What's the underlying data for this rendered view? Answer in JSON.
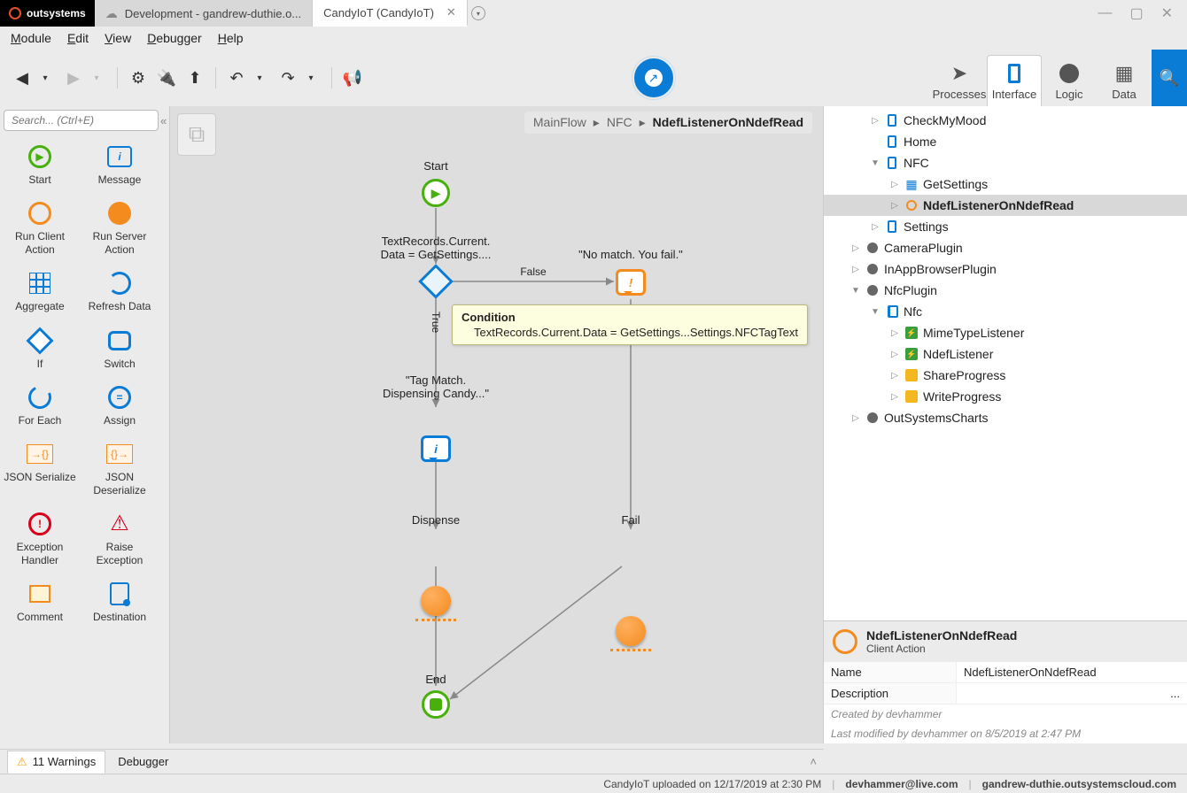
{
  "titlebar": {
    "brand": "outsystems",
    "tabs": [
      {
        "label": "Development - gandrew-duthie.o..."
      },
      {
        "label": "CandyIoT (CandyIoT)"
      }
    ]
  },
  "menubar": {
    "items": [
      "Module",
      "Edit",
      "View",
      "Debugger",
      "Help"
    ]
  },
  "layer_tabs": [
    "Processes",
    "Interface",
    "Logic",
    "Data"
  ],
  "toolbox": {
    "search_placeholder": "Search... (Ctrl+E)",
    "items": [
      "Start",
      "Message",
      "Run Client Action",
      "Run Server Action",
      "Aggregate",
      "Refresh Data",
      "If",
      "Switch",
      "For Each",
      "Assign",
      "JSON Serialize",
      "JSON Deserialize",
      "Exception Handler",
      "Raise Exception",
      "Comment",
      "Destination"
    ]
  },
  "breadcrumb": [
    "MainFlow",
    "NFC",
    "NdefListenerOnNdefRead"
  ],
  "flow": {
    "start_label": "Start",
    "if_label_a": "TextRecords.Current.",
    "if_label_b": "Data = GetSettings....",
    "true_label": "True",
    "false_label": "False",
    "fail_msg": "\"No match. You fail.\"",
    "ok_msg_a": "\"Tag Match.",
    "ok_msg_b": "Dispensing Candy...\"",
    "dispense_label": "Dispense",
    "fail_label": "Fail",
    "end_label": "End"
  },
  "tooltip": {
    "title": "Condition",
    "body": "TextRecords.Current.Data = GetSettings...Settings.NFCTagText"
  },
  "tree": {
    "items": [
      {
        "indent": 1,
        "exp": "▷",
        "icon": "mobile",
        "label": "CheckMyMood"
      },
      {
        "indent": 1,
        "exp": "",
        "icon": "mobile",
        "label": "Home"
      },
      {
        "indent": 1,
        "exp": "▼",
        "icon": "mobile",
        "label": "NFC"
      },
      {
        "indent": 2,
        "exp": "▷",
        "icon": "grid",
        "label": "GetSettings"
      },
      {
        "indent": 2,
        "exp": "▷",
        "icon": "action",
        "label": "NdefListenerOnNdefRead",
        "selected": true
      },
      {
        "indent": 1,
        "exp": "▷",
        "icon": "mobile",
        "label": "Settings"
      },
      {
        "indent": 0,
        "exp": "▷",
        "icon": "gray",
        "label": "CameraPlugin"
      },
      {
        "indent": 0,
        "exp": "▷",
        "icon": "gray",
        "label": "InAppBrowserPlugin"
      },
      {
        "indent": 0,
        "exp": "▼",
        "icon": "gray",
        "label": "NfcPlugin"
      },
      {
        "indent": 1,
        "exp": "▼",
        "icon": "mobile2",
        "label": "Nfc"
      },
      {
        "indent": 2,
        "exp": "▷",
        "icon": "event",
        "label": "MimeTypeListener"
      },
      {
        "indent": 2,
        "exp": "▷",
        "icon": "event",
        "label": "NdefListener"
      },
      {
        "indent": 2,
        "exp": "▷",
        "icon": "prog",
        "label": "ShareProgress"
      },
      {
        "indent": 2,
        "exp": "▷",
        "icon": "prog",
        "label": "WriteProgress"
      },
      {
        "indent": 0,
        "exp": "▷",
        "icon": "gray",
        "label": "OutSystemsCharts"
      }
    ]
  },
  "properties": {
    "title": "NdefListenerOnNdefRead",
    "subtitle": "Client Action",
    "rows": [
      {
        "key": "Name",
        "value": "NdefListenerOnNdefRead"
      },
      {
        "key": "Description",
        "value": "",
        "ellipsis": "..."
      }
    ],
    "meta": [
      "Created by devhammer",
      "Last modified by devhammer on 8/5/2019 at 2:47 PM"
    ]
  },
  "bottom_tabs": {
    "warnings": "11 Warnings",
    "debugger": "Debugger"
  },
  "statusbar": {
    "upload": "CandyIoT uploaded on 12/17/2019 at 2:30 PM",
    "user": "devhammer@live.com",
    "host": "gandrew-duthie.outsystemscloud.com"
  }
}
